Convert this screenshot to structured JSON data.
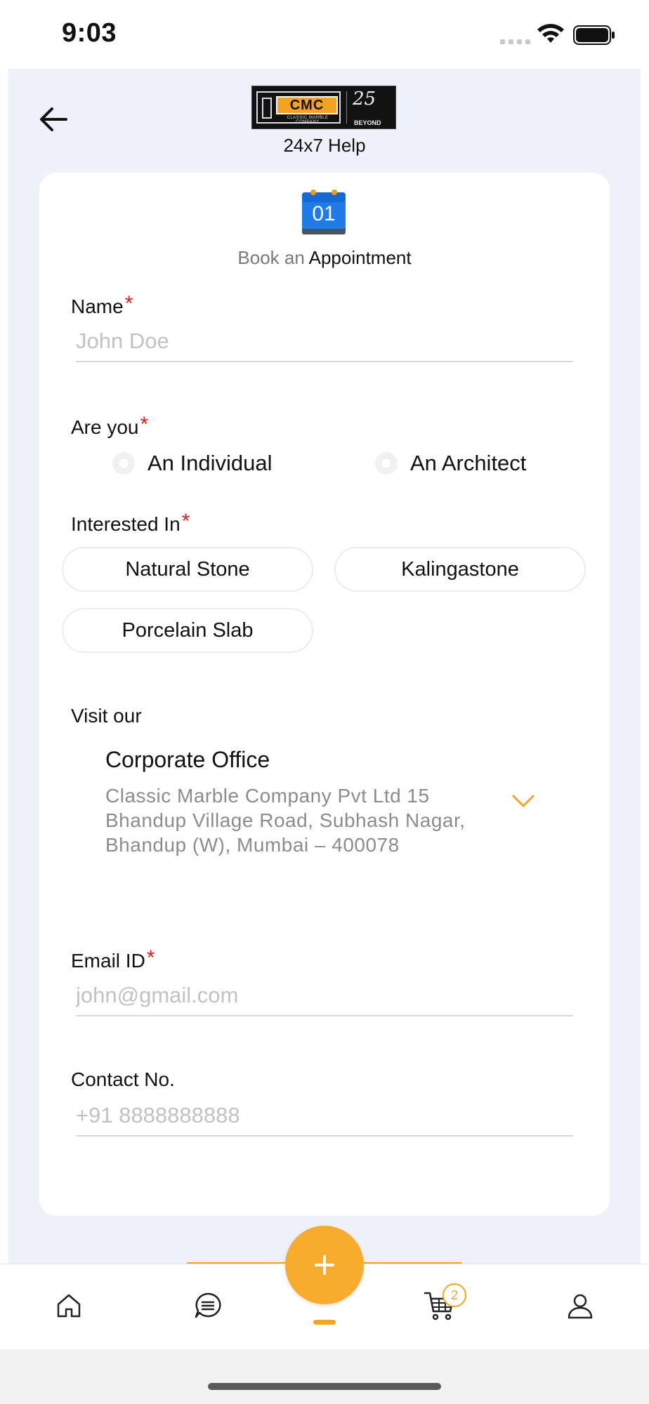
{
  "status_bar": {
    "time": "9:03"
  },
  "header": {
    "logo": {
      "brand": "CMC",
      "tagline": "CLASSIC MARBLE COMPANY",
      "anniversary": "25",
      "anniversary_sub": "BEYOND"
    },
    "help_text": "24x7 Help"
  },
  "card": {
    "calendar_day": "01",
    "title_prefix": "Book an",
    "title_main": "Appointment"
  },
  "form": {
    "name": {
      "label": "Name",
      "required_mark": "*",
      "placeholder": "John Doe",
      "value": ""
    },
    "are_you": {
      "label": "Are you",
      "required_mark": "*",
      "options": [
        "An Individual",
        "An Architect"
      ]
    },
    "interested_in": {
      "label": "Interested In",
      "required_mark": "*",
      "options": [
        "Natural Stone",
        "Kalingastone",
        "Porcelain Slab"
      ]
    },
    "visit": {
      "label": "Visit our",
      "office_title": "Corporate Office",
      "office_address": "Classic Marble Company Pvt Ltd 15 Bhandup Village Road, Subhash Nagar, Bhandup (W), Mumbai – 400078"
    },
    "email": {
      "label": "Email ID",
      "required_mark": "*",
      "placeholder": "john@gmail.com",
      "value": ""
    },
    "contact": {
      "label": "Contact No.",
      "placeholder": "+91 8888888888",
      "value": ""
    }
  },
  "bottom_nav": {
    "items": [
      "home-icon",
      "chat-icon",
      "add-icon",
      "cart-icon",
      "profile-icon"
    ],
    "cart_count": "2"
  },
  "colors": {
    "accent": "#F7AC2E",
    "background": "#EEF1F9",
    "required": "#E01B1B",
    "card": "#FFFFFF"
  }
}
